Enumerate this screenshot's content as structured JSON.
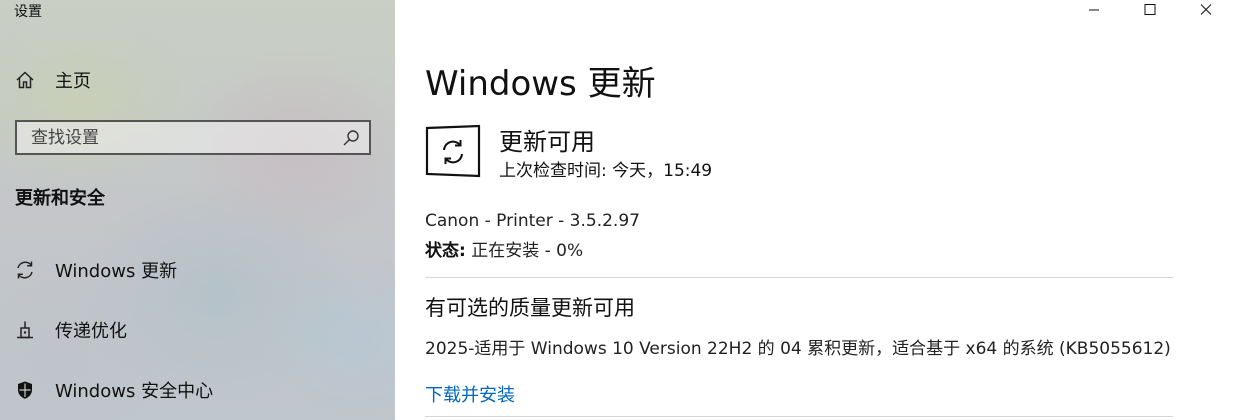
{
  "app": {
    "title": "设置"
  },
  "sidebar": {
    "home_label": "主页",
    "search_placeholder": "查找设置",
    "section_heading": "更新和安全",
    "items": [
      {
        "label": "Windows 更新",
        "icon": "sync-icon"
      },
      {
        "label": "传递优化",
        "icon": "delivery-optimization-icon"
      },
      {
        "label": "Windows 安全中心",
        "icon": "shield-icon"
      }
    ]
  },
  "window_controls": {
    "minimize": "minimize-icon",
    "maximize": "maximize-icon",
    "close": "close-icon"
  },
  "main": {
    "title": "Windows 更新",
    "status_title": "更新可用",
    "status_subtitle": "上次检查时间: 今天，15:49",
    "update_name": "Canon - Printer - 3.5.2.97",
    "state_label": "状态:",
    "state_value": " 正在安装 - 0%",
    "optional_heading": "有可选的质量更新可用",
    "optional_description": "2025-适用于 Windows 10 Version 22H2 的 04 累积更新，适合基于 x64 的系统 (KB5055612)",
    "download_link": "下载并安装"
  },
  "colors": {
    "link": "#0067c0",
    "divider": "#d6d6d6"
  }
}
